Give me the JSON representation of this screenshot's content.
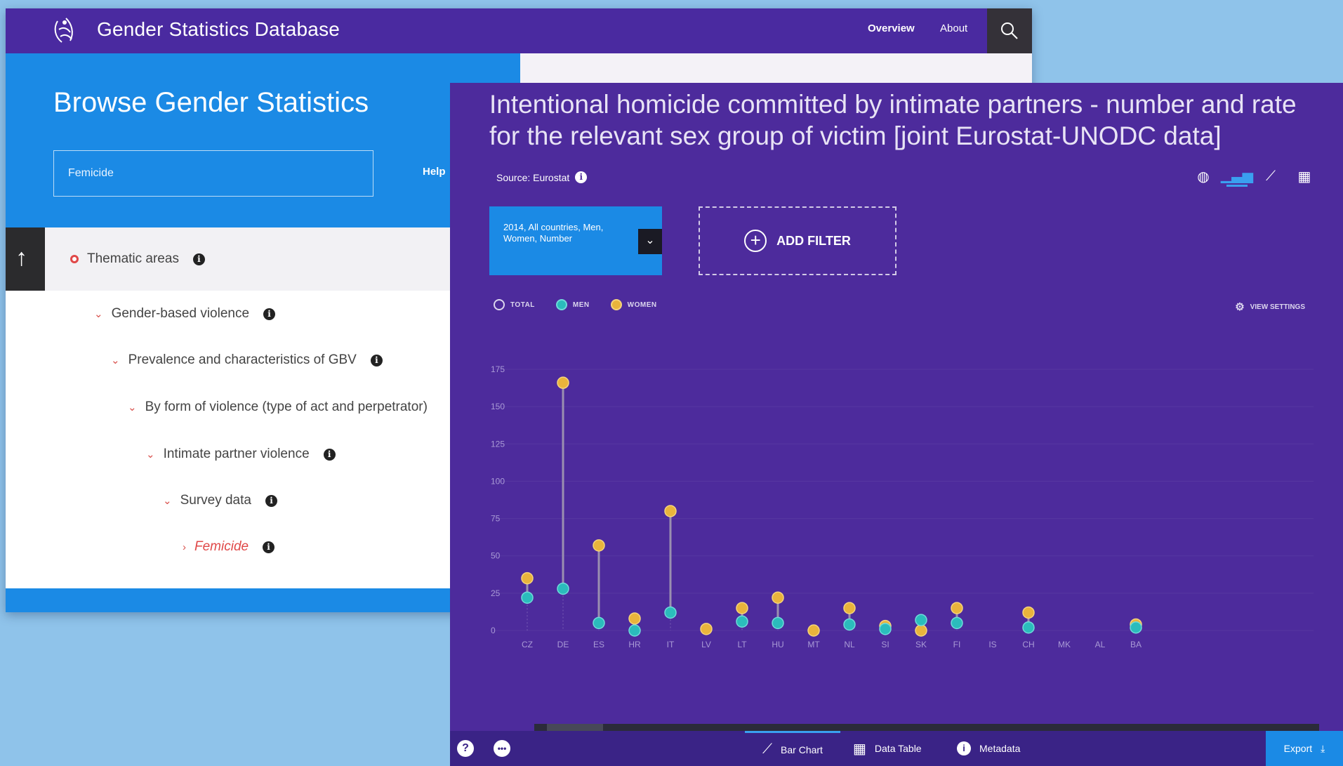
{
  "header": {
    "app_title": "Gender Statistics Database",
    "nav": [
      "Overview",
      "About"
    ]
  },
  "browse": {
    "title": "Browse Gender Statistics",
    "search_value": "Femicide",
    "help_label": "Help"
  },
  "tree": {
    "root": "Thematic areas",
    "items": [
      {
        "label": "Gender-based violence"
      },
      {
        "label": "Prevalence and characteristics of GBV"
      },
      {
        "label": "By form of violence (type of act and perpetrator)"
      },
      {
        "label": "Intimate partner violence"
      },
      {
        "label": "Survey data"
      },
      {
        "label": "Femicide"
      }
    ]
  },
  "panel": {
    "title": "Intentional homicide committed by intimate partners - number and rate for the relevant sex group of victim [joint Eurostat-UNODC data]",
    "source_label": "Source: Eurostat",
    "filter_text": "2014, All countries, Men, Women, Number",
    "add_filter_label": "ADD FILTER",
    "view_settings_label": "VIEW SETTINGS",
    "legend": [
      "TOTAL",
      "MEN",
      "WOMEN"
    ],
    "bottom": {
      "bar_chart": "Bar Chart",
      "data_table": "Data Table",
      "metadata": "Metadata",
      "export": "Export"
    }
  },
  "colors": {
    "men": "#2bbcbc",
    "women": "#e9b43c",
    "bg": "#4d2b9c",
    "accent": "#1b8ae5"
  },
  "chart_data": {
    "type": "scatter",
    "categories": [
      "CZ",
      "DE",
      "ES",
      "HR",
      "IT",
      "LV",
      "LT",
      "HU",
      "MT",
      "NL",
      "SI",
      "SK",
      "FI",
      "IS",
      "CH",
      "MK",
      "AL",
      "BA"
    ],
    "series": [
      {
        "name": "MEN",
        "values": [
          22,
          28,
          5,
          0,
          12,
          null,
          6,
          5,
          null,
          4,
          1,
          7,
          5,
          null,
          2,
          null,
          null,
          2
        ]
      },
      {
        "name": "WOMEN",
        "values": [
          35,
          166,
          57,
          8,
          80,
          1,
          15,
          22,
          0,
          15,
          3,
          0,
          15,
          null,
          12,
          null,
          null,
          4
        ]
      }
    ],
    "ylim": [
      0,
      175
    ],
    "yticks": [
      0,
      25,
      50,
      75,
      100,
      125,
      150,
      175
    ]
  }
}
